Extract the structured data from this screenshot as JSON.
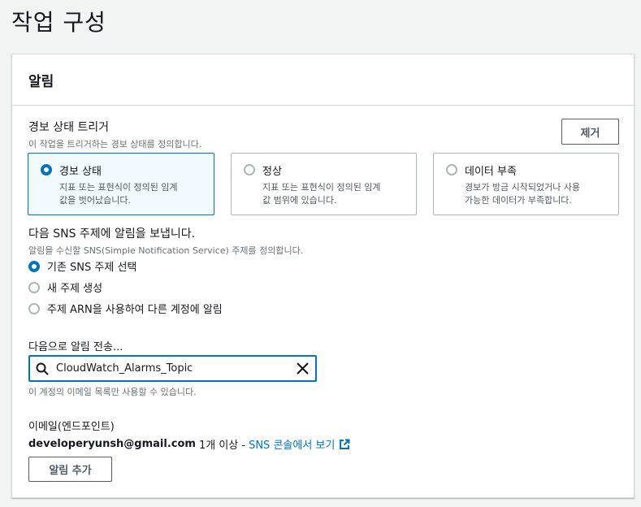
{
  "page": {
    "title": "작업 구성"
  },
  "panel": {
    "title": "알림",
    "remove_label": "제거",
    "trigger": {
      "label": "경보 상태 트리거",
      "description": "이 작업을 트리거하는 경보 상태를 정의합니다.",
      "options": [
        {
          "title": "경보 상태",
          "description_line1": "지표 또는 표현식이 정의된 임계",
          "description_line2": "값을 벗어났습니다.",
          "selected": true
        },
        {
          "title": "정상",
          "description_line1": "지표 또는 표현식이 정의된 임계",
          "description_line2": "값 범위에 있습니다.",
          "selected": false
        },
        {
          "title": "데이터 부족",
          "description_line1": "경보가 방금 시작되었거나 사용",
          "description_line2": "가능한 데이터가 부족합니다.",
          "selected": false
        }
      ]
    },
    "sns": {
      "label": "다음 SNS 주제에 알림을 보냅니다.",
      "description": "알림을 수신할 SNS(Simple Notification Service) 주제를 정의합니다.",
      "options": [
        {
          "label": "기존 SNS 주제 선택",
          "selected": true
        },
        {
          "label": "새 주제 생성",
          "selected": false
        },
        {
          "label": "주제 ARN을 사용하여 다른 계정에 알림",
          "selected": false
        }
      ]
    },
    "send_to": {
      "label": "다음으로 알림 전송...",
      "value": "CloudWatch_Alarms_Topic",
      "hint": "이 계정의 이메일 목록만 사용할 수 있습니다."
    },
    "endpoint": {
      "label": "이메일(엔드포인트)",
      "email": "developeryunsh@gmail.com",
      "suffix": "1개 이상 -",
      "link": "SNS 콘솔에서 보기"
    },
    "add_label": "알림 추가"
  },
  "colors": {
    "accent": "#0073bb",
    "border": "#aab7b8",
    "background": "#f2f3f3"
  }
}
